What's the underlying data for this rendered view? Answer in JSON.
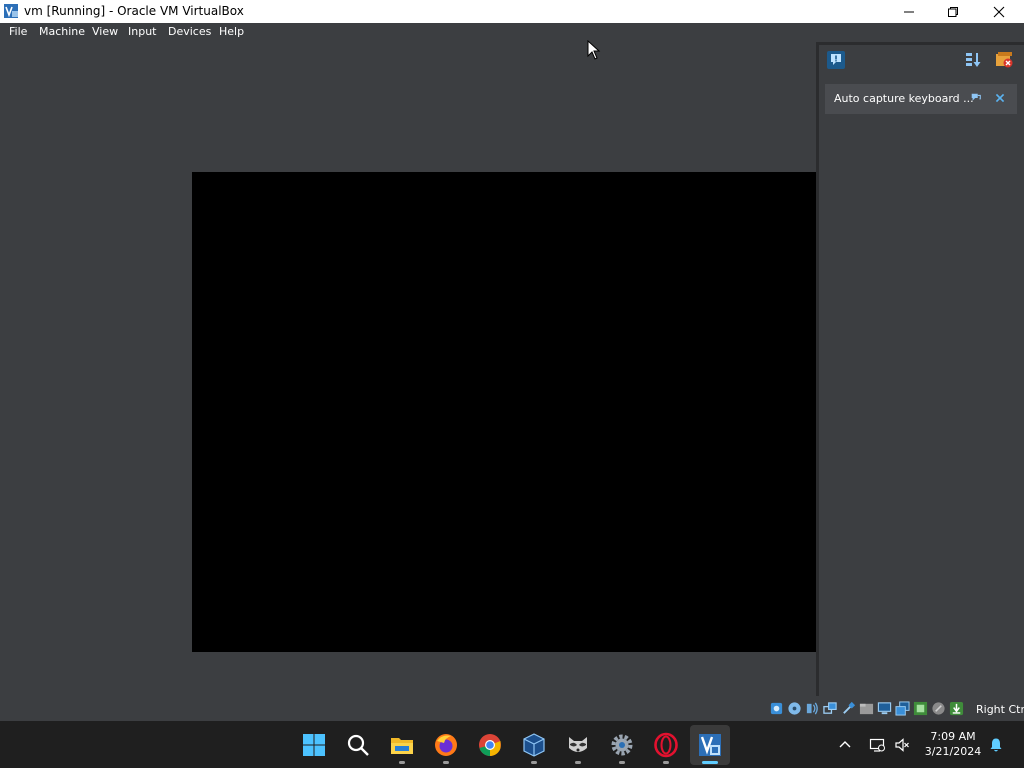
{
  "window": {
    "title": "vm [Running] - Oracle VM VirtualBox",
    "app_icon": "virtualbox-icon",
    "controls": [
      "minimize-icon",
      "restore-icon",
      "close-icon"
    ]
  },
  "menubar": {
    "items": [
      {
        "label": "File"
      },
      {
        "label": "Machine"
      },
      {
        "label": "View"
      },
      {
        "label": "Input"
      },
      {
        "label": "Devices"
      },
      {
        "label": "Help"
      }
    ]
  },
  "vm": {
    "screen_color": "#000000"
  },
  "side_panel": {
    "top_icons": [
      "notification-center-icon",
      "sort-icon",
      "toggle-panel-icon"
    ],
    "notification": {
      "text": "Auto capture keyboard ...",
      "actions": [
        "pin-icon",
        "close-icon"
      ]
    }
  },
  "statusbar": {
    "icons": [
      "hard-disk-icon",
      "optical-drive-icon",
      "audio-icon",
      "network-icon",
      "usb-icon",
      "shared-folders-icon",
      "display-icon",
      "recording-icon",
      "cpu-icon",
      "mouse-integration-icon",
      "keyboard-capture-icon"
    ],
    "host_key": "Right Ctrl"
  },
  "taskbar": {
    "apps": [
      "windows-start-icon",
      "search-icon",
      "file-explorer-icon",
      "firefox-icon",
      "chrome-icon",
      "virtualbox-manager-icon",
      "raccoon-app-icon",
      "settings-icon",
      "opera-icon",
      "virtualbox-vm-icon"
    ],
    "tray_icons": [
      "chevron-up-icon",
      "network-icon",
      "volume-muted-icon",
      "notification-bell-icon"
    ],
    "time": "7:09 AM",
    "date": "3/21/2024"
  },
  "colors": {
    "window_bg": "#3c3e41",
    "taskbar_bg": "#1f1f1f",
    "accent": "#60cdff"
  }
}
